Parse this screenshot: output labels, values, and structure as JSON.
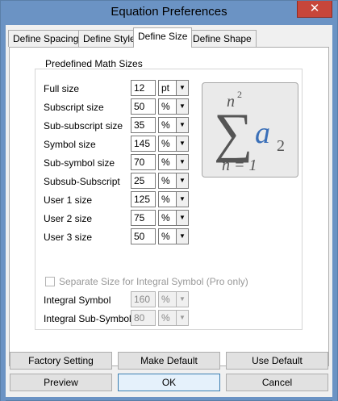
{
  "window": {
    "title": "Equation Preferences",
    "close_glyph": "✕"
  },
  "tabs": [
    {
      "label": "Define Spacing",
      "active": false
    },
    {
      "label": "Define Style",
      "active": false
    },
    {
      "label": "Define Size",
      "active": true
    },
    {
      "label": "Define Shape",
      "active": false
    }
  ],
  "panel": {
    "group_label": "Predefined Math Sizes",
    "rows": [
      {
        "label": "Full size",
        "value": "12",
        "unit": "pt"
      },
      {
        "label": "Subscript size",
        "value": "50",
        "unit": "%"
      },
      {
        "label": "Sub-subscript size",
        "value": "35",
        "unit": "%"
      },
      {
        "label": "Symbol size",
        "value": "145",
        "unit": "%"
      },
      {
        "label": "Sub-symbol size",
        "value": "70",
        "unit": "%"
      },
      {
        "label": "Subsub-Subscript",
        "value": "25",
        "unit": "%"
      },
      {
        "label": "User 1 size",
        "value": "125",
        "unit": "%"
      },
      {
        "label": "User 2 size",
        "value": "75",
        "unit": "%"
      },
      {
        "label": "User 3 size",
        "value": "50",
        "unit": "%"
      }
    ],
    "integral_checkbox": {
      "label": "Separate Size for Integral Symbol (Pro only)",
      "checked": false
    },
    "integral_rows": [
      {
        "label": "Integral Symbol",
        "value": "160",
        "unit": "%"
      },
      {
        "label": "Integral Sub-Symbol",
        "value": "80",
        "unit": "%"
      }
    ],
    "preview": {
      "superscript": "2",
      "base_letter": "a",
      "subscript": "2",
      "lower_limit": "n = 1",
      "upper_limit": "n"
    }
  },
  "buttons": {
    "factory_setting": "Factory Setting",
    "make_default": "Make Default",
    "use_default": "Use Default",
    "preview": "Preview",
    "ok": "OK",
    "cancel": "Cancel"
  },
  "colors": {
    "titlebar": "#6b93c4",
    "close": "#c7463a",
    "preview_accent": "#3a6fb8",
    "sigma": "#555555"
  }
}
